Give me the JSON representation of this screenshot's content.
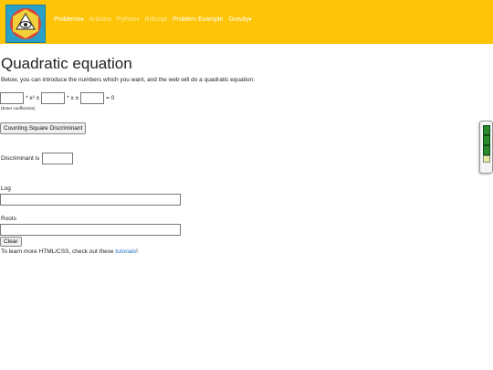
{
  "nav": {
    "items": [
      {
        "label": "Problems",
        "caret": "▾",
        "dim": false
      },
      {
        "label": "Arduino",
        "caret": "",
        "dim": true
      },
      {
        "label": "Python",
        "caret": "▾",
        "dim": true
      },
      {
        "label": "RiScript",
        "caret": "",
        "dim": true
      },
      {
        "label": "Problem Example",
        "caret": "",
        "dim": false
      },
      {
        "label": "Gravity",
        "caret": "▾",
        "dim": false
      }
    ]
  },
  "page": {
    "title": "Quadratic equation",
    "intro": "Below, you can introduce the numbers which you want, and the web will do a quadratic equation:",
    "term_x2": "* x² ±",
    "term_x": "* x ±",
    "equals": "= 0",
    "hint": "(Enter coefficients)",
    "discriminant_button": "Counting Square Discriminant",
    "discriminant_label": "Discriminant is",
    "log_label": "Log",
    "roots_label": "Roots",
    "clear_button": "Clear",
    "footer_text": "To learn more HTML/CSS, check out these ",
    "footer_link": "tutorials",
    "footer_end": "!"
  },
  "colors": {
    "navbar": "#fec407",
    "link": "#1a73c9"
  },
  "icons": {
    "logo": "eye-in-triangle-logo",
    "side_widget": "green-status-widget"
  }
}
